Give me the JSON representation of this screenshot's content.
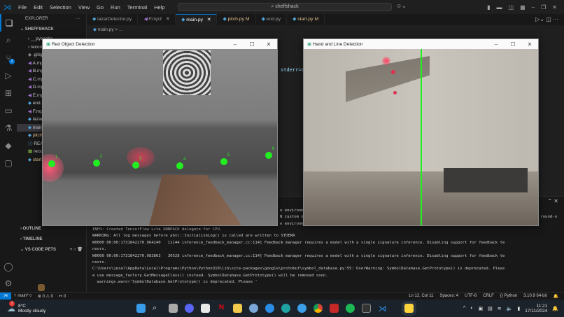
{
  "menu": [
    "File",
    "Edit",
    "Selection",
    "View",
    "Go",
    "Run",
    "Terminal",
    "Help"
  ],
  "search": "sheffshack",
  "explorer": {
    "title": "EXPLORER",
    "root": "SHEFFSHACK",
    "items": [
      {
        "label": "__pycache__",
        "type": "folder"
      },
      {
        "label": "recordings",
        "type": "folder"
      },
      {
        "label": ".gitignore",
        "type": "git"
      },
      {
        "label": "A.mp3",
        "type": "audio"
      },
      {
        "label": "B.mp3",
        "type": "audio"
      },
      {
        "label": "C.mp3",
        "type": "audio"
      },
      {
        "label": "D.mp3",
        "type": "audio"
      },
      {
        "label": "E.mp3",
        "type": "audio"
      },
      {
        "label": "end.py",
        "type": "py"
      },
      {
        "label": "F.mp3",
        "type": "audio"
      },
      {
        "label": "lazarDetector.py",
        "type": "py"
      },
      {
        "label": "main.py",
        "type": "py",
        "selected": true
      },
      {
        "label": "pitch.py",
        "type": "py-mod"
      },
      {
        "label": "README.md",
        "type": "info"
      },
      {
        "label": "recordings.csv",
        "type": "csv"
      },
      {
        "label": "start.py",
        "type": "py-mod"
      }
    ],
    "sections": [
      "OUTLINE",
      "TIMELINE",
      "VS CODE PETS"
    ],
    "scm_badge": "2"
  },
  "tabs": [
    {
      "label": "lazarDetector.py"
    },
    {
      "label": "F.mp3"
    },
    {
      "label": "main.py",
      "active": true
    },
    {
      "label": "pitch.py",
      "badge": "M"
    },
    {
      "label": "end.py"
    },
    {
      "label": "start.py",
      "badge": "M"
    }
  ],
  "breadcrumb": "main.py > ...",
  "editor_fragment": "stderr=s",
  "terminal": {
    "partial": [
      "e environm",
      "N custom o",
      "e environm"
    ],
    "partial_right": "round-o",
    "lines": [
      "INFO: Created TensorFlow Lite XNNPACK delegate for CPU.",
      "WARNING: All log messages before absl::InitializeLog() is called are written to STDERR",
      "W0000 00:00:1731842270.964240   11144 inference_feedback_manager.cc:114] Feedback manager requires a model with a single signature inference. Disabling support for feedback te",
      "nsors.",
      "W0000 00:00:1731842270.983863   30528 inference_feedback_manager.cc:114] Feedback manager requires a model with a single signature inference. Disabling support for feedback te",
      "nsors.",
      "C:\\Users\\jesal\\AppData\\Local\\Programs\\Python\\Python310\\lib\\site-packages\\google\\protobuf\\symbol_database.py:55: UserWarning: SymbolDatabase.GetPrototype() is deprecated. Pleas",
      "e use message_factory.GetMessageClass() instead. SymbolDatabase.GetPrototype() will be removed soon.",
      "  warnings.warn('SymbolDatabase.GetPrototype() is deprecated. Please '"
    ]
  },
  "status": {
    "branch": "main*",
    "errors": "0",
    "warnings": "0",
    "ports": "0",
    "position": "Ln 12, Col 11",
    "spaces": "Spaces: 4",
    "encoding": "UTF-8",
    "eol": "CRLF",
    "language": "{} Python",
    "interpreter": "3.10.9 64-bit"
  },
  "windows": {
    "red": {
      "title": "Red Object Detection",
      "labels": [
        "1",
        "2",
        "3",
        "4",
        "5",
        "6"
      ]
    },
    "hand": {
      "title": "Hand and Line Detection"
    }
  },
  "taskbar": {
    "temp": "8°C",
    "weather": "Mostly cloudy",
    "weather_badge": "1",
    "time": "11:21",
    "date": "17/11/2024"
  },
  "colors": {
    "accent": "#0078d4",
    "detect": "#22ee22",
    "modified": "#e2c08d"
  }
}
